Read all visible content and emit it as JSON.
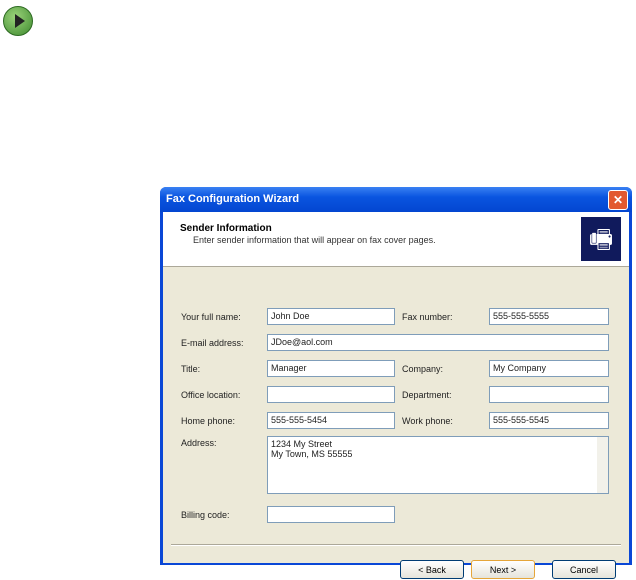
{
  "window_title": "Fax Configuration Wizard",
  "header": {
    "title": "Sender Information",
    "subtitle": "Enter sender information that will appear on fax cover pages."
  },
  "fields": {
    "full_name": {
      "label": "Your full name:",
      "value": "John Doe"
    },
    "fax_number": {
      "label": "Fax number:",
      "value": "555-555-5555"
    },
    "email": {
      "label": "E-mail address:",
      "value": "JDoe@aol.com"
    },
    "title": {
      "label": "Title:",
      "value": "Manager"
    },
    "company": {
      "label": "Company:",
      "value": "My Company"
    },
    "office": {
      "label": "Office location:",
      "value": ""
    },
    "department": {
      "label": "Department:",
      "value": ""
    },
    "home_phone": {
      "label": "Home phone:",
      "value": "555-555-5454"
    },
    "work_phone": {
      "label": "Work phone:",
      "value": "555-555-5545"
    },
    "address": {
      "label": "Address:",
      "line1": "1234 My Street",
      "line2": "My Town, MS 55555"
    },
    "billing": {
      "label": "Billing code:",
      "value": ""
    }
  },
  "buttons": {
    "back": "< Back",
    "next": "Next >",
    "cancel": "Cancel"
  },
  "close": "✕",
  "fax_icon": "🖷"
}
